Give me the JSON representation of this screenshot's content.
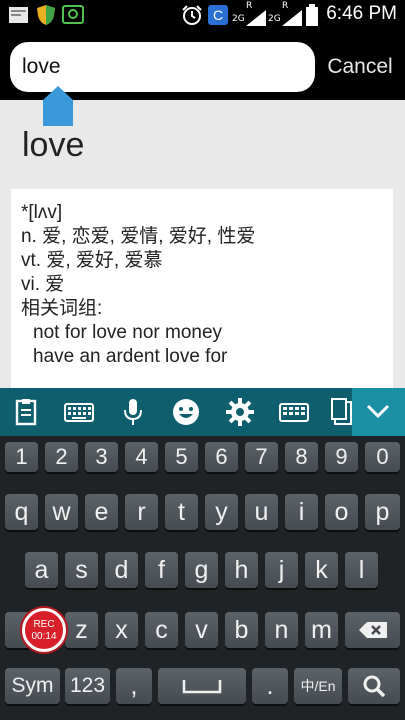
{
  "status_bar": {
    "time": "6:46 PM",
    "icons": [
      "app-notification-icon",
      "shield-icon",
      "screen-recorder-icon",
      "alarm-icon",
      "c-app-icon",
      "signal-2g-icon",
      "signal-2g-icon",
      "battery-icon"
    ],
    "network_1": "2G",
    "network_2": "2G",
    "roaming": "R"
  },
  "search": {
    "value": "love",
    "cancel_label": "Cancel"
  },
  "entry": {
    "headword": "love",
    "lines": [
      "*[lʌv]",
      "n. 爱, 恋爱, 爱情, 爱好, 性爱",
      "vt. 爱, 爱好, 爱慕",
      "vi. 爱",
      "相关词组:",
      "not for love nor money",
      "have an ardent love for"
    ]
  },
  "keyboard_toolbar": {
    "icons": [
      "clipboard-icon",
      "keyboard-icon",
      "microphone-icon",
      "emoji-icon",
      "settings-icon",
      "keyboard-layout-icon",
      "one-hand-icon",
      "collapse-chevron-icon"
    ]
  },
  "keyboard": {
    "numbers": [
      "1",
      "2",
      "3",
      "4",
      "5",
      "6",
      "7",
      "8",
      "9",
      "0"
    ],
    "row1": [
      "q",
      "w",
      "e",
      "r",
      "t",
      "y",
      "u",
      "i",
      "o",
      "p"
    ],
    "row2": [
      "a",
      "s",
      "d",
      "f",
      "g",
      "h",
      "j",
      "k",
      "l"
    ],
    "row3": [
      "z",
      "x",
      "c",
      "v",
      "b",
      "n",
      "m"
    ],
    "sym": "Sym",
    "num123": "123",
    "comma": ",",
    "period": ".",
    "lang": "中/En"
  },
  "recorder": {
    "label": "REC",
    "time": "00:14",
    "color": "#d8202a"
  },
  "colors": {
    "toolbar": "#0f5e6e",
    "toolbar_accent": "#1a8fa3",
    "keyboard_bg": "#1f2326",
    "handle": "#3a9ad9"
  }
}
